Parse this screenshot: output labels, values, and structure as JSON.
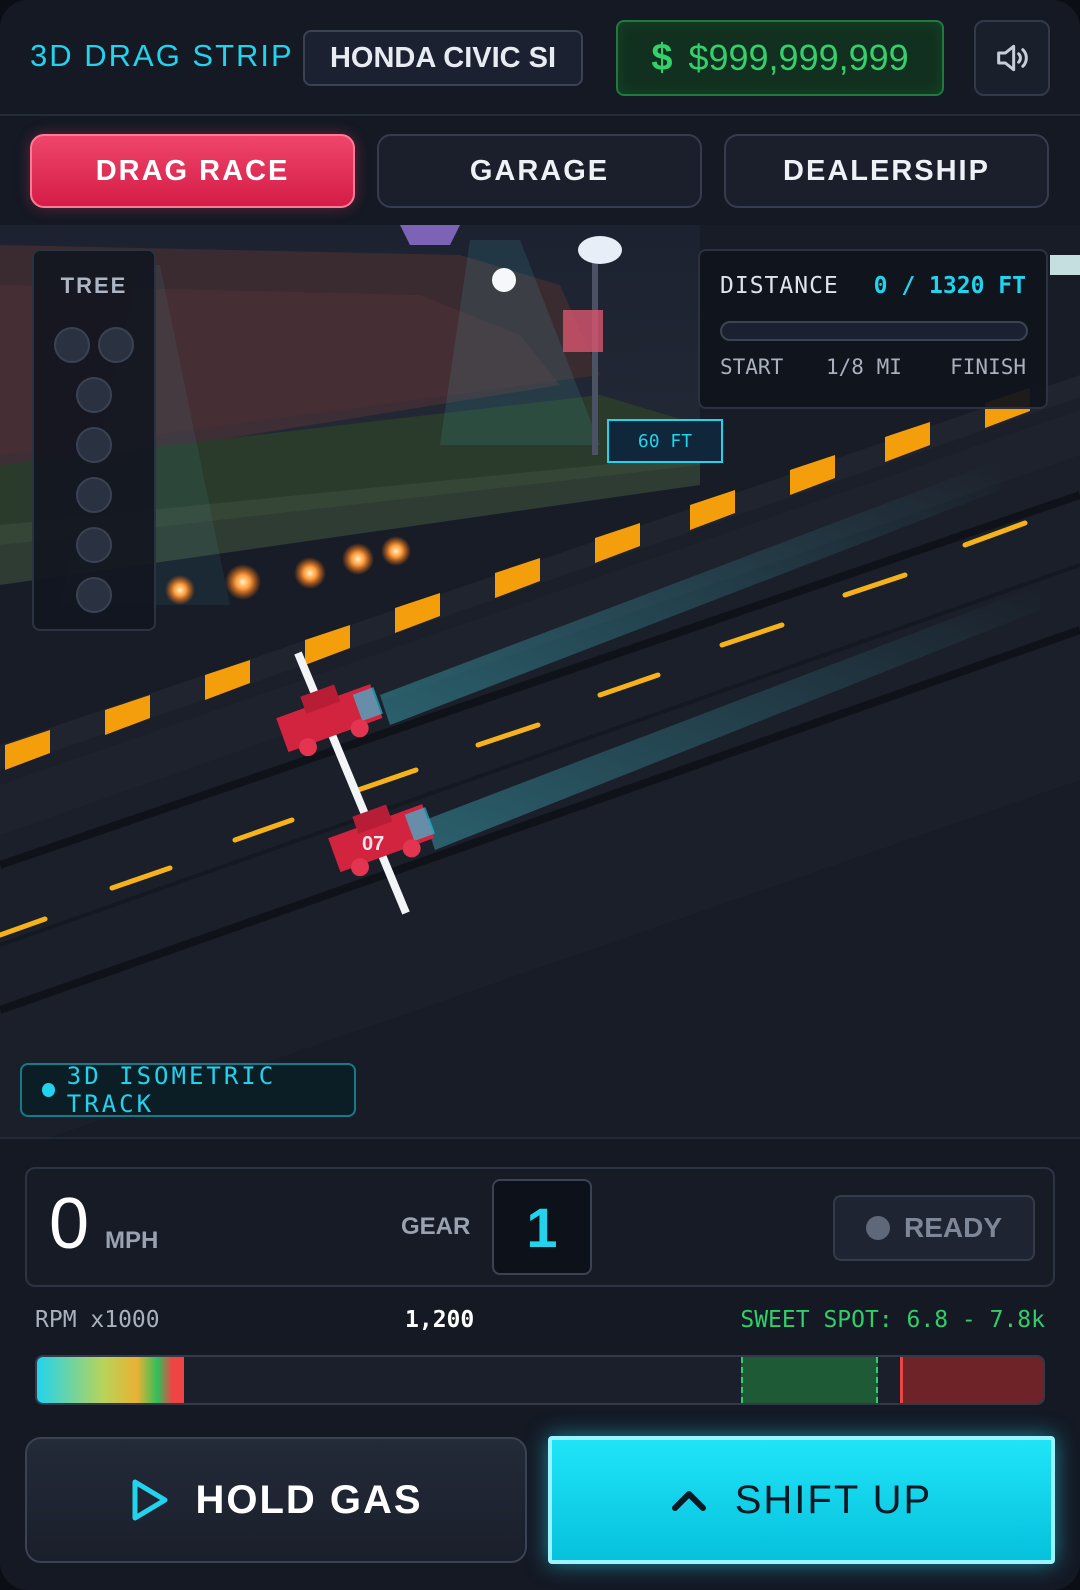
{
  "header": {
    "app_title": "3D DRAG STRIP",
    "car_name": "HONDA CIVIC SI",
    "money_symbol": "$",
    "money": "$999,999,999",
    "sound_icon": "speaker-icon"
  },
  "tabs": [
    {
      "label": "DRAG RACE",
      "active": true
    },
    {
      "label": "GARAGE",
      "active": false
    },
    {
      "label": "DEALERSHIP",
      "active": false
    }
  ],
  "scene": {
    "tree": {
      "title": "TREE"
    },
    "distance": {
      "label": "DISTANCE",
      "value": "0 / 1320 FT",
      "progress": 0,
      "start": "START",
      "mid": "1/8 MI",
      "finish": "FINISH"
    },
    "marker_60ft": "60 FT",
    "car_number": "07",
    "track_label": "3D ISOMETRIC TRACK"
  },
  "dashboard": {
    "speed": "0",
    "speed_unit": "MPH",
    "gear_label": "GEAR",
    "gear": "1",
    "ready": "READY",
    "rpm_label": "RPM x1000",
    "rpm_value": "1,200",
    "sweet_spot": "SWEET SPOT: 6.8 - 7.8k",
    "rpm_gauge": {
      "fill_fraction": 0.146,
      "sweet_start": 0.7,
      "sweet_end": 0.836,
      "redline": 0.858
    },
    "hold_gas": "HOLD GAS",
    "shift_up": "SHIFT UP"
  },
  "colors": {
    "accent": "#22d3ee",
    "active_tab": "#e83358",
    "money": "#34d06b",
    "sweet_spot": "#2fcf6a",
    "redline": "#ef4444",
    "stripe": "#f59e0b"
  }
}
